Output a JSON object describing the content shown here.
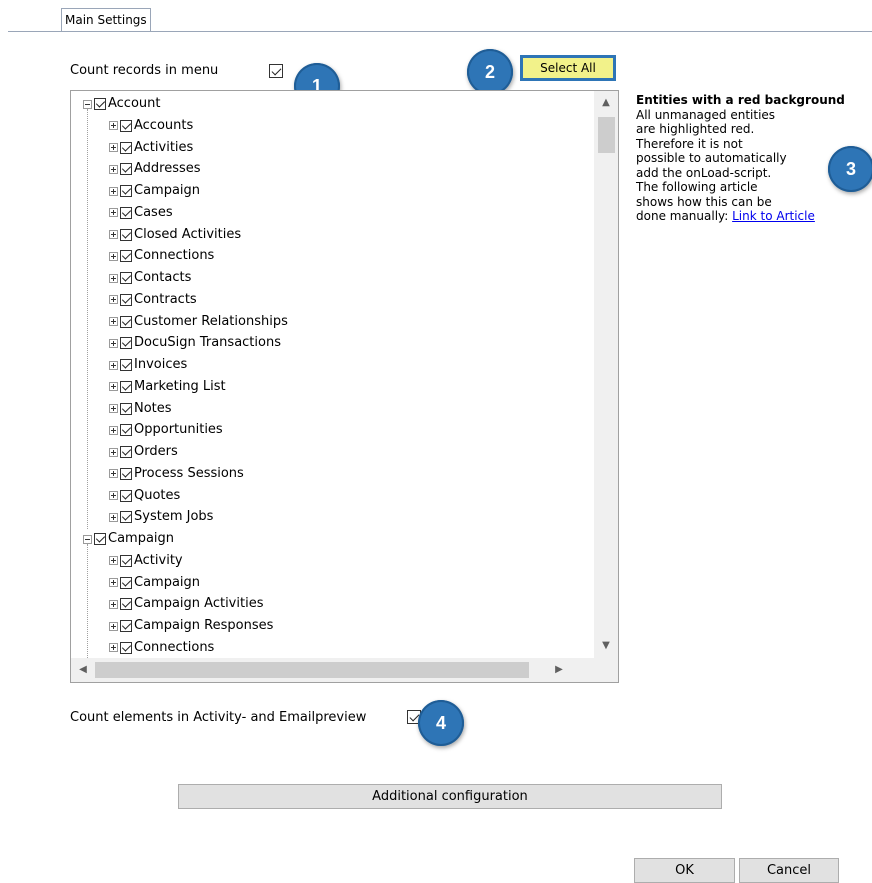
{
  "tab": {
    "label": "Main Settings"
  },
  "count_records": {
    "label": "Count records in menu",
    "checked": true
  },
  "select_all": {
    "label": "Select All"
  },
  "badges": [
    "1",
    "2",
    "3",
    "4"
  ],
  "tree": {
    "groups": [
      {
        "label": "Account",
        "children": [
          "Accounts",
          "Activities",
          "Addresses",
          "Campaign",
          "Cases",
          "Closed Activities",
          "Connections",
          "Contacts",
          "Contracts",
          "Customer Relationships",
          "DocuSign Transactions",
          "Invoices",
          "Marketing List",
          "Notes",
          "Opportunities",
          "Orders",
          "Process Sessions",
          "Quotes",
          "System Jobs"
        ]
      },
      {
        "label": "Campaign",
        "children": [
          "Activity",
          "Campaign",
          "Campaign Activities",
          "Campaign Responses",
          "Connections"
        ]
      }
    ]
  },
  "info": {
    "heading": "Entities with a red background",
    "lines": [
      "All unmanaged entities",
      "are highlighted red.",
      "Therefore it is not",
      "possible to automatically",
      "add the onLoad-script.",
      "The following article",
      "shows how this can be"
    ],
    "last_line_prefix": "done manually: ",
    "link": "Link to Article"
  },
  "count_elements": {
    "label": "Count elements in Activity- and Emailpreview",
    "checked": true
  },
  "additional_config": {
    "label": "Additional configuration"
  },
  "ok": {
    "label": "OK"
  },
  "cancel": {
    "label": "Cancel"
  },
  "colors": {
    "badge": "#2e75b6",
    "select_all_bg": "#f2f28a",
    "link": "#0000ee"
  }
}
